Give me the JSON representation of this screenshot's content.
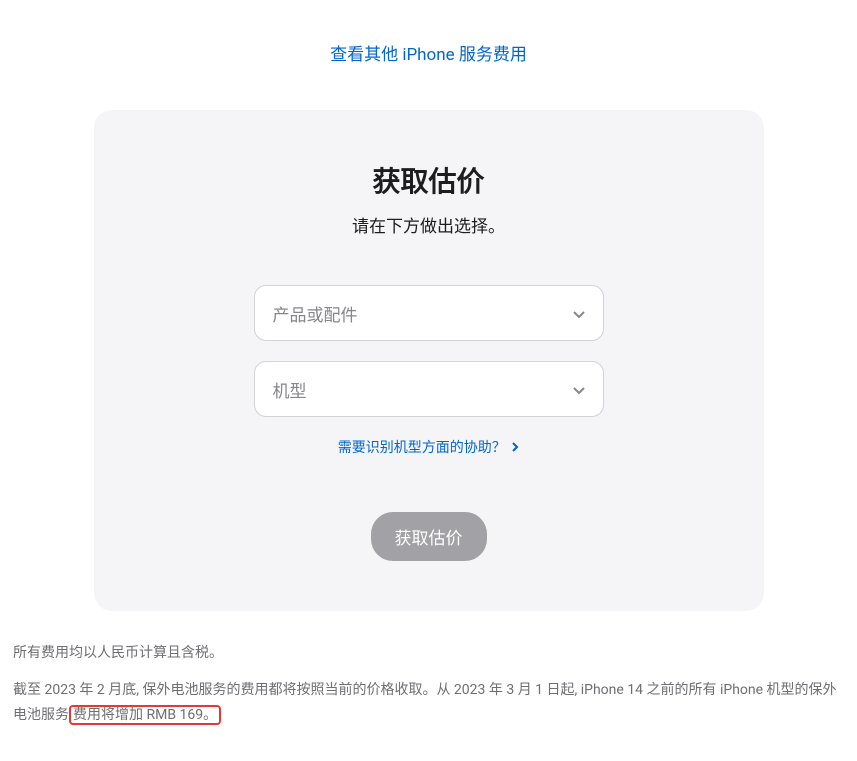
{
  "topLink": {
    "label": "查看其他 iPhone 服务费用"
  },
  "card": {
    "title": "获取估价",
    "subtitle": "请在下方做出选择。",
    "select1": {
      "placeholder": "产品或配件"
    },
    "select2": {
      "placeholder": "机型"
    },
    "helpLink": {
      "label": "需要识别机型方面的协助？"
    },
    "submitButton": {
      "label": "获取估价"
    }
  },
  "footer": {
    "line1": "所有费用均以人民币计算且含税。",
    "line2_part1": "截至 2023 年 2 月底, 保外电池服务的费用都将按照当前的价格收取。从 2023 年 3 月 1 日起, iPhone 14 之前的所有 iPhone 机型的保外电池服务",
    "line2_highlight": "费用将增加 RMB 169。"
  }
}
